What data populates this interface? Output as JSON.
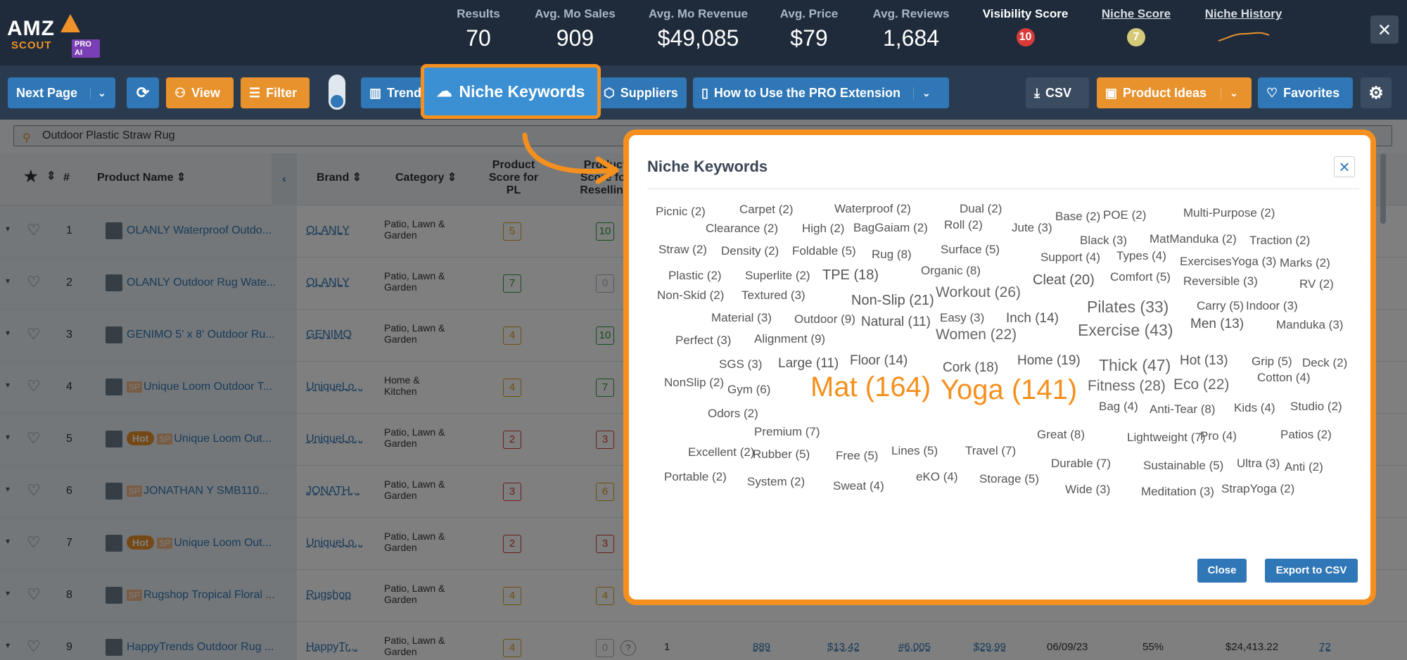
{
  "brand": {
    "logo_text": "AMZ",
    "logo_sub": "SCOUT",
    "logo_badge": "PRO AI"
  },
  "stats": [
    {
      "label": "Results",
      "value": "70"
    },
    {
      "label": "Avg. Mo Sales",
      "value": "909"
    },
    {
      "label": "Avg. Mo Revenue",
      "value": "$49,085"
    },
    {
      "label": "Avg. Price",
      "value": "$79"
    },
    {
      "label": "Avg. Reviews",
      "value": "1,684"
    }
  ],
  "visibility": {
    "label": "Visibility Score",
    "value": "10",
    "color": "#d93b3b"
  },
  "niche_score": {
    "label": "Niche Score",
    "value": "7",
    "color": "#d6c97a"
  },
  "niche_history": {
    "label": "Niche History"
  },
  "toolbar": {
    "next_page": "Next Page",
    "view": "View",
    "filter": "Filter",
    "trends": "Trend",
    "niche_keywords": "Niche Keywords",
    "suppliers": "Suppliers",
    "how_to": "How to Use the PRO Extension",
    "csv": "CSV",
    "product_ideas": "Product Ideas",
    "favorites": "Favorites"
  },
  "search": {
    "value": "Outdoor Plastic Straw Rug"
  },
  "table": {
    "headers": {
      "num": "#",
      "product_name": "Product Name",
      "brand": "Brand",
      "category": "Category",
      "pl_score": "Product Score for PL",
      "resell_score": "Product Score for Reselling"
    },
    "rows": [
      {
        "num": "1",
        "name": "OLANLY Waterproof Outdo...",
        "brand": "OLANLY",
        "category": "Patio, Lawn & Garden",
        "pl": "5",
        "pl_color": "#d8a21a",
        "rs": "10",
        "rs_color": "#2e9a3e",
        "tags": []
      },
      {
        "num": "2",
        "name": "OLANLY Outdoor Rug Wate...",
        "brand": "OLANLY",
        "category": "Patio, Lawn & Garden",
        "pl": "7",
        "pl_color": "#2e9a3e",
        "rs": "0",
        "rs_color": "#aab3bd",
        "tags": []
      },
      {
        "num": "3",
        "name": "GENIMO 5' x 8' Outdoor Ru...",
        "brand": "GENIMO",
        "category": "Patio, Lawn & Garden",
        "pl": "4",
        "pl_color": "#d8a21a",
        "rs": "10",
        "rs_color": "#2e9a3e",
        "tags": []
      },
      {
        "num": "4",
        "name": "Unique Loom Outdoor T...",
        "brand": "UniqueLo...",
        "category": "Home & Kitchen",
        "pl": "4",
        "pl_color": "#d8a21a",
        "rs": "7",
        "rs_color": "#2e9a3e",
        "tags": [
          "SP"
        ]
      },
      {
        "num": "5",
        "name": "Unique Loom Out...",
        "brand": "UniqueLo...",
        "category": "Patio, Lawn & Garden",
        "pl": "2",
        "pl_color": "#d93b3b",
        "rs": "3",
        "rs_color": "#d93b3b",
        "tags": [
          "Hot",
          "SP"
        ]
      },
      {
        "num": "6",
        "name": "JONATHAN Y SMB110...",
        "brand": "JONATH...",
        "category": "Patio, Lawn & Garden",
        "pl": "3",
        "pl_color": "#d93b3b",
        "rs": "6",
        "rs_color": "#d8a21a",
        "tags": [
          "SP"
        ]
      },
      {
        "num": "7",
        "name": "Unique Loom Out...",
        "brand": "UniqueLo...",
        "category": "Patio, Lawn & Garden",
        "pl": "2",
        "pl_color": "#d93b3b",
        "rs": "3",
        "rs_color": "#d93b3b",
        "tags": [
          "Hot",
          "SP"
        ]
      },
      {
        "num": "8",
        "name": "Rugshop Tropical Floral ...",
        "brand": "Rugshop",
        "category": "Patio, Lawn & Garden",
        "pl": "4",
        "pl_color": "#d8a21a",
        "rs": "4",
        "rs_color": "#d8a21a",
        "tags": [
          "SP"
        ]
      },
      {
        "num": "9",
        "name": "HappyTrends Outdoor Rug ...",
        "brand": "HappyTr...",
        "category": "Patio, Lawn & Garden",
        "pl": "4",
        "pl_color": "#d8a21a",
        "rs": "0",
        "rs_color": "#aab3bd",
        "tags": []
      }
    ],
    "row9_extra": {
      "sellers": "1",
      "sales": "889",
      "price": "$13.42",
      "rank": "#6,005",
      "price2": "$29.99",
      "date": "06/09/23",
      "pct": "55%",
      "revenue": "$24,413.22",
      "reviews": "72"
    }
  },
  "modal": {
    "title": "Niche Keywords",
    "close": "Close",
    "export": "Export to CSV",
    "keywords": [
      "Picnic (2)",
      "Carpet (2)",
      "Waterproof (2)",
      "Dual (2)",
      "Base (2)",
      "POE (2)",
      "Multi-Purpose (2)",
      "Clearance (2)",
      "High (2)",
      "BagGaiam (2)",
      "Roll (2)",
      "Jute (3)",
      "Black (3)",
      "MatManduka (2)",
      "Traction (2)",
      "Straw (2)",
      "Density (2)",
      "Foldable (5)",
      "Rug (8)",
      "Surface (5)",
      "Support (4)",
      "Types (4)",
      "ExercisesYoga (3)",
      "Marks (2)",
      "Plastic (2)",
      "Superlite (2)",
      "TPE (18)",
      "Organic (8)",
      "Cleat (20)",
      "Comfort (5)",
      "Reversible (3)",
      "RV (2)",
      "Non-Skid (2)",
      "Textured (3)",
      "Non-Slip (21)",
      "Workout (26)",
      "Pilates (33)",
      "Carry (5)",
      "Indoor (3)",
      "Material (3)",
      "Outdoor (9)",
      "Natural (11)",
      "Easy (3)",
      "Inch (14)",
      "Exercise (43)",
      "Men (13)",
      "Manduka (3)",
      "Perfect (3)",
      "Alignment (9)",
      "Women (22)",
      "SGS (3)",
      "Large (11)",
      "Floor (14)",
      "Cork (18)",
      "Home (19)",
      "Thick (47)",
      "Hot (13)",
      "Grip (5)",
      "Deck (2)",
      "NonSlip (2)",
      "Gym (6)",
      "Mat (164)",
      "Yoga (141)",
      "Fitness (28)",
      "Eco (22)",
      "Cotton (4)",
      "Odors (2)",
      "Bag (4)",
      "Anti-Tear (8)",
      "Kids (4)",
      "Studio (2)",
      "Premium (7)",
      "Great (8)",
      "Lightweight (7)",
      "Pro (4)",
      "Patios (2)",
      "Excellent (2)",
      "Rubber (5)",
      "Free (5)",
      "Lines (5)",
      "Travel (7)",
      "Durable (7)",
      "Sustainable (5)",
      "Ultra (3)",
      "Anti (2)",
      "Portable (2)",
      "System (2)",
      "Sweat (4)",
      "eKO (4)",
      "Storage (5)",
      "Wide (3)",
      "Meditation (3)",
      "StrapYoga (2)"
    ]
  },
  "colors": {
    "accent": "#f5901e",
    "primary": "#2f77b6",
    "header_bg": "#1f2b3a",
    "toolbar_bg": "#2b3b4f"
  }
}
